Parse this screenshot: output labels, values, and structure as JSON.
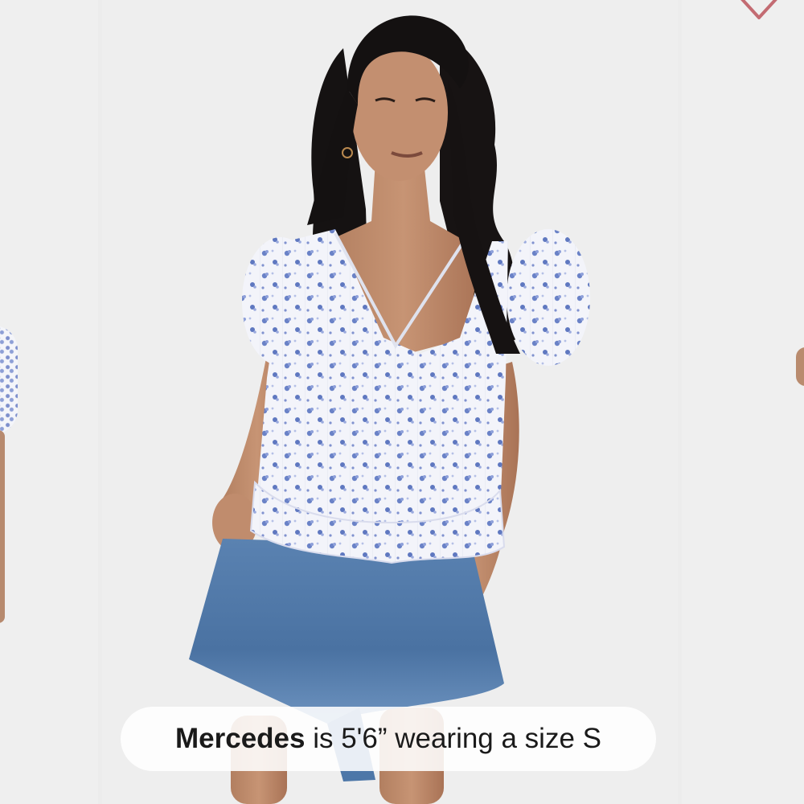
{
  "caption": {
    "name": "Mercedes",
    "text": " is 5'6” wearing a size S"
  },
  "colors": {
    "heart_outline": "#c36b72",
    "denim": "#4d77a8",
    "floral_blue": "#6a82c7"
  },
  "icons": {
    "favorite": "heart-icon"
  }
}
